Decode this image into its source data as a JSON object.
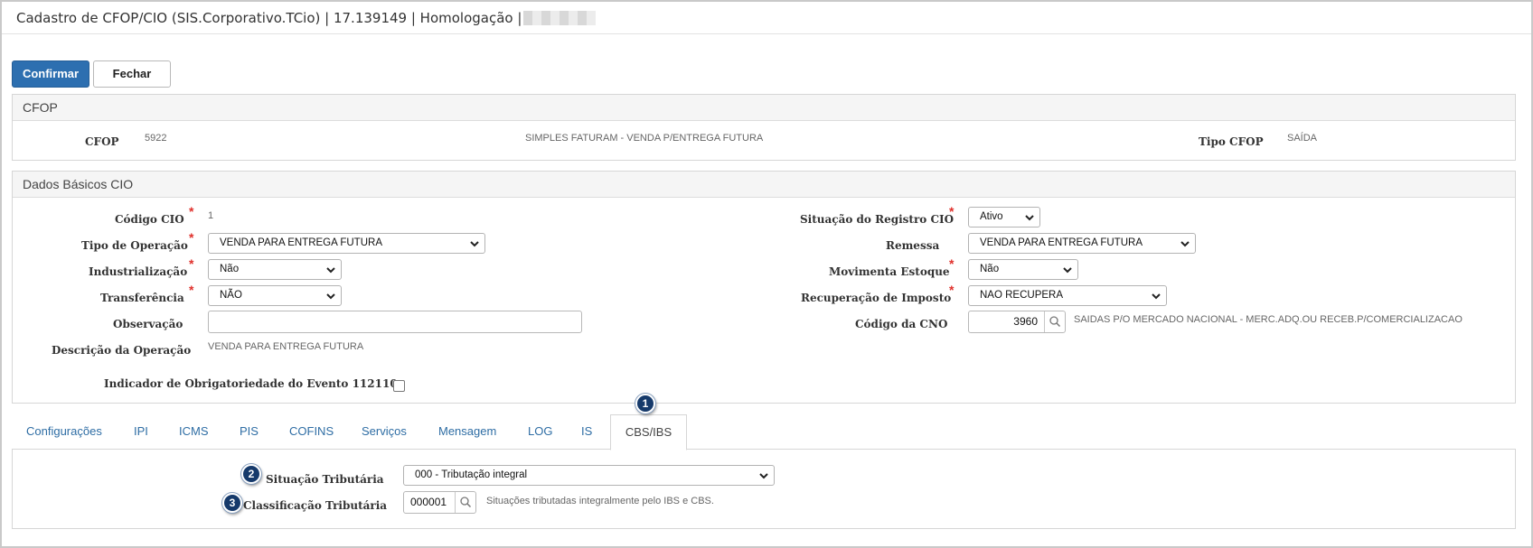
{
  "window": {
    "title": "Cadastro de CFOP/CIO (SIS.Corporativo.TCio) | 17.139149 | Homologação |"
  },
  "toolbar": {
    "confirm_label": "Confirmar",
    "close_label": "Fechar"
  },
  "cfop_panel": {
    "title": "CFOP",
    "cfop_label": "CFOP",
    "cfop_value": "5922",
    "description": "SIMPLES FATURAM - VENDA P/ENTREGA FUTURA",
    "tipo_label": "Tipo CFOP",
    "tipo_value": "SAÍDA"
  },
  "basic_panel": {
    "title": "Dados Básicos CIO",
    "required_marker": "*",
    "codigo_cio": {
      "label": "Código CIO",
      "value": "1"
    },
    "tipo_operacao": {
      "label": "Tipo de Operação",
      "value": "VENDA PARA ENTREGA FUTURA"
    },
    "industrializacao": {
      "label": "Industrialização",
      "value": "Não"
    },
    "transferencia": {
      "label": "Transferência",
      "value": "NÃO"
    },
    "observacao": {
      "label": "Observação",
      "value": ""
    },
    "descricao": {
      "label": "Descrição da Operação",
      "value": "VENDA PARA ENTREGA FUTURA"
    },
    "indicador": {
      "label": "Indicador de Obrigatoriedade do Evento 112110",
      "checked": false
    },
    "situacao_registro": {
      "label": "Situação do Registro CIO",
      "value": "Ativo"
    },
    "remessa": {
      "label": "Remessa",
      "value": "VENDA PARA ENTREGA FUTURA"
    },
    "movimenta_estoque": {
      "label": "Movimenta Estoque",
      "value": "Não"
    },
    "recuperacao": {
      "label": "Recuperação de Imposto",
      "value": "NAO RECUPERA"
    },
    "codigo_cno": {
      "label": "Código da CNO",
      "value": "3960",
      "description": "SAIDAS P/O MERCADO NACIONAL - MERC.ADQ.OU RECEB.P/COMERCIALIZACAO"
    }
  },
  "tabs": [
    {
      "label": "Configurações"
    },
    {
      "label": "IPI"
    },
    {
      "label": "ICMS"
    },
    {
      "label": "PIS"
    },
    {
      "label": "COFINS"
    },
    {
      "label": "Serviços"
    },
    {
      "label": "Mensagem"
    },
    {
      "label": "LOG"
    },
    {
      "label": "IS"
    },
    {
      "label": "CBS/IBS",
      "active": true
    }
  ],
  "cbs_ibs": {
    "situacao_label": "Situação Tributária",
    "situacao_value": "000 - Tributação integral",
    "classificacao_label": "Classificação Tributária",
    "classificacao_value": "000001",
    "classificacao_description": "Situações tributadas integralmente pelo IBS e CBS."
  },
  "callouts": [
    "1",
    "2",
    "3"
  ],
  "colors": {
    "primary_button": "#2d6fb0",
    "tab_link": "#2e6da4",
    "required": "#e0302b",
    "callout": "#163a6b"
  }
}
